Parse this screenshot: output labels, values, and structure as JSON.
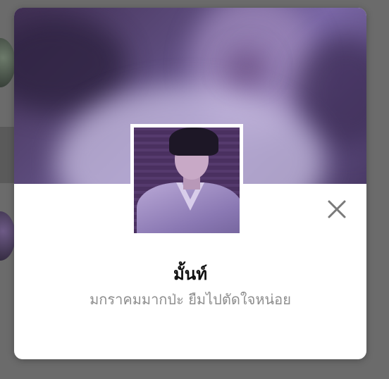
{
  "profile": {
    "display_name": "มั้นท์",
    "status_message": "มกราคมมากป่ะ ยืมไปตัดใจหน่อย"
  },
  "icons": {
    "close": "close-icon"
  },
  "colors": {
    "overlay": "#6b6b6b",
    "card_background": "#ffffff",
    "name_text": "#111111",
    "status_text": "#8e8e8e",
    "cover_tint": "#7a67a6"
  }
}
